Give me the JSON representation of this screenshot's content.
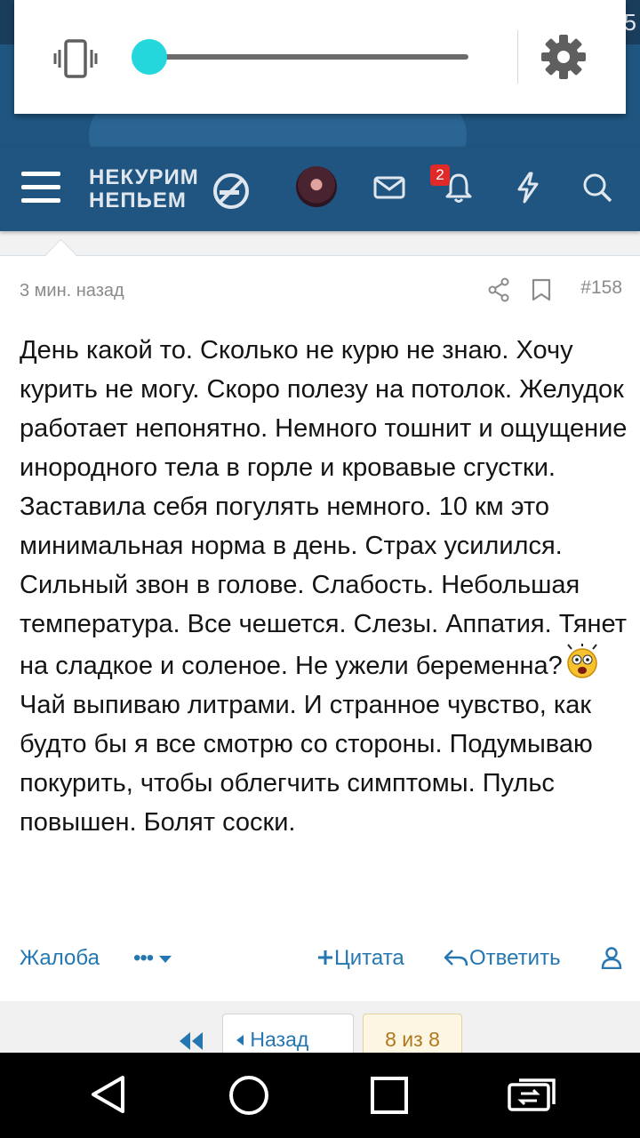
{
  "status_bar": {
    "clock_fragment": "5"
  },
  "volume_panel": {
    "level": 0.0,
    "ringer_mode": "vibrate"
  },
  "header": {
    "logo_line1": "НЕКУРИМ",
    "logo_line2": "НЕПЬЕМ",
    "notification_count": "2"
  },
  "post": {
    "time": "3 мин. назад",
    "number": "#158",
    "text_part1": "День какой то. Сколько не курю не знаю. Хочу курить не могу. Скоро полезу на потолок. Желудок работает непонятно. Немного тошнит и ощущение инородного тела в горле и кровавые сгустки. Заставила себя погулять немного. 10 км это минимальная норма в день. Страх усилился. Сильный звон в голове. Слабость. Небольшая температура. Все чешется. Слезы. Аппатия. Тянет на сладкое и соленое. Не ужели беременна?",
    "text_part2": "Чай выпиваю литрами. И странное чувство, как будто бы я все смотрю со стороны. Подумываю покурить, чтобы облегчить симптомы. Пульс повышен. Болят соски.",
    "emoji": "shocked-emoji"
  },
  "actions": {
    "report": "Жалоба",
    "more": "•••",
    "quote": "Цитата",
    "reply": "Ответить"
  },
  "pagination": {
    "back": "Назад",
    "count": "8 из 8"
  },
  "colors": {
    "header_bg": "#1f5580",
    "link": "#2577b1",
    "slider_thumb": "#23d7dc",
    "badge": "#e02a2a"
  }
}
